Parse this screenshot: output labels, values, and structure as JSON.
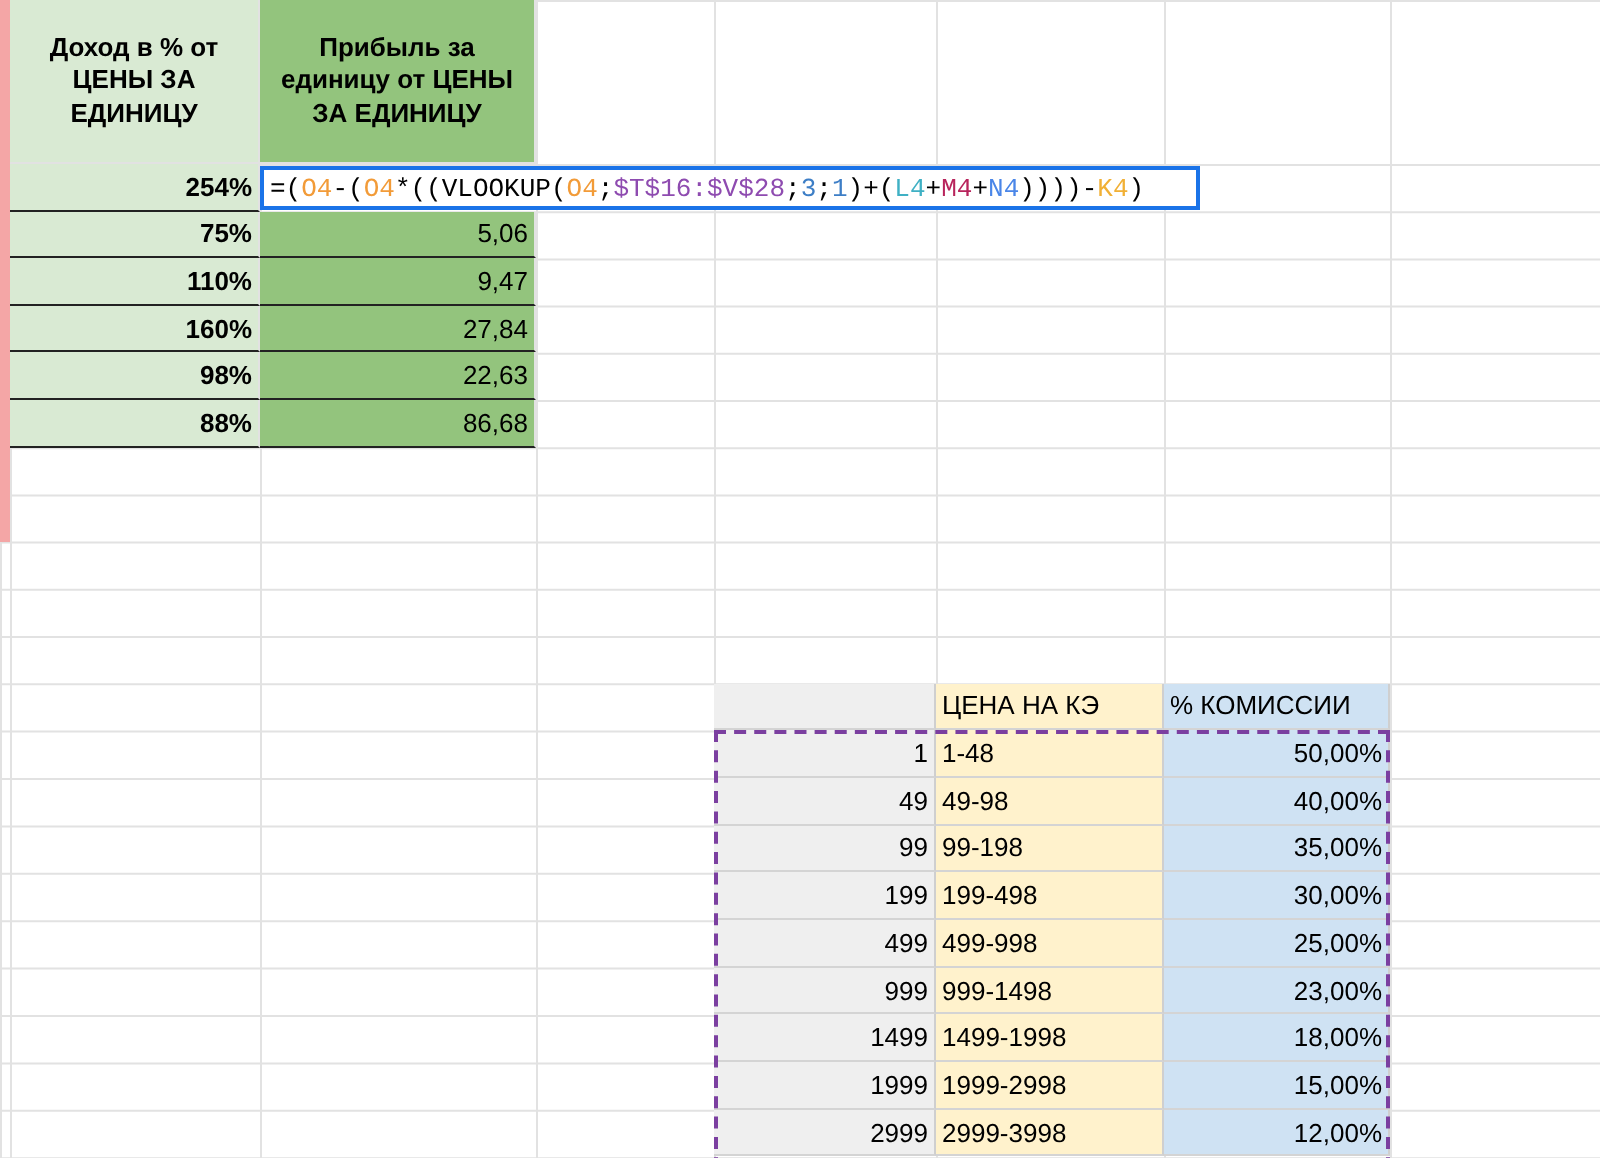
{
  "profit_table": {
    "columns": [
      "Доход в % от ЦЕНЫ ЗА ЕДИНИЦУ",
      "Прибыль за единицу  от ЦЕНЫ ЗА ЕДИНИЦУ"
    ],
    "rows": [
      {
        "income": "254%"
      },
      {
        "income": "75%",
        "profit": "5,06"
      },
      {
        "income": "110%",
        "profit": "9,47"
      },
      {
        "income": "160%",
        "profit": "27,84"
      },
      {
        "income": "98%",
        "profit": "22,63"
      },
      {
        "income": "88%",
        "profit": "86,68"
      }
    ]
  },
  "formula_editor": {
    "tokens": [
      {
        "text": "=(",
        "color": "#000000"
      },
      {
        "text": "O4",
        "color": "#f29b38"
      },
      {
        "text": "-(",
        "color": "#000000"
      },
      {
        "text": "O4",
        "color": "#f29b38"
      },
      {
        "text": "*((VLOOKUP(",
        "color": "#000000"
      },
      {
        "text": "O4",
        "color": "#f29b38"
      },
      {
        "text": ";",
        "color": "#000000"
      },
      {
        "text": "$T$16:$V$28",
        "color": "#8e4bb0"
      },
      {
        "text": ";",
        "color": "#000000"
      },
      {
        "text": "3",
        "color": "#3d7ec6"
      },
      {
        "text": ";",
        "color": "#000000"
      },
      {
        "text": "1",
        "color": "#3d7ec6"
      },
      {
        "text": ")+(",
        "color": "#000000"
      },
      {
        "text": "L4",
        "color": "#3fb0c4"
      },
      {
        "text": "+",
        "color": "#000000"
      },
      {
        "text": "M4",
        "color": "#b8245c"
      },
      {
        "text": "+",
        "color": "#000000"
      },
      {
        "text": "N4",
        "color": "#4a86e8"
      },
      {
        "text": "))))-",
        "color": "#000000"
      },
      {
        "text": "K4",
        "color": "#f1b035"
      },
      {
        "text": ")",
        "color": "#000000"
      }
    ]
  },
  "commission_table": {
    "columns": [
      "",
      "ЦЕНА НА КЭ",
      "% КОМИССИИ"
    ],
    "rows": [
      [
        "1",
        "1-48",
        "50,00%"
      ],
      [
        "49",
        "49-98",
        "40,00%"
      ],
      [
        "99",
        "99-198",
        "35,00%"
      ],
      [
        "199",
        "199-498",
        "30,00%"
      ],
      [
        "499",
        "499-998",
        "25,00%"
      ],
      [
        "999",
        "999-1498",
        "23,00%"
      ],
      [
        "1499",
        "1499-1998",
        "18,00%"
      ],
      [
        "1999",
        "1999-2998",
        "15,00%"
      ],
      [
        "2999",
        "2999-3998",
        "12,00%"
      ]
    ]
  }
}
